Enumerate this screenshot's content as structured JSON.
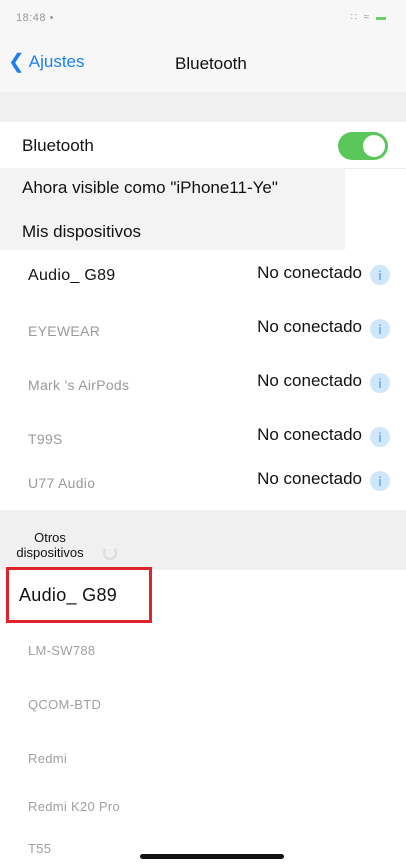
{
  "status_bar": {
    "time": "18:48 •",
    "icons_text": "∷ ≈",
    "battery_text": "▬"
  },
  "nav": {
    "back_label": "Ajustes",
    "title": "Bluetooth"
  },
  "bluetooth": {
    "label": "Bluetooth",
    "enabled": true,
    "toggle_color": "#5ac75a"
  },
  "visibility_text": "Ahora visible como \"iPhone11-Ye\"",
  "my_devices": {
    "header": "Mis dispositivos",
    "items": [
      {
        "name": "Audio_ G89",
        "status": "No conectado"
      },
      {
        "name": "EYEWEAR",
        "status": "No conectado"
      },
      {
        "name": "Mark 's AirPods",
        "status": "No conectado"
      },
      {
        "name": "T99S",
        "status": "No conectado"
      },
      {
        "name": "U77 Audio",
        "status": "No conectado"
      }
    ]
  },
  "other_devices": {
    "header": "Otros dispositivos",
    "highlighted": "Audio_ G89",
    "items": [
      {
        "name": "LM-SW788"
      },
      {
        "name": "QCOM-BTD"
      },
      {
        "name": "Redmi"
      },
      {
        "name": "Redmi K20 Pro"
      },
      {
        "name": "T55"
      }
    ]
  },
  "colors": {
    "accent": "#1a7ff0",
    "highlight_border": "#e0232b",
    "info_icon": "#cfe6fb"
  },
  "icons": {
    "back": "chevron-left-icon",
    "info": "info-icon",
    "spinner": "spinner-icon"
  }
}
